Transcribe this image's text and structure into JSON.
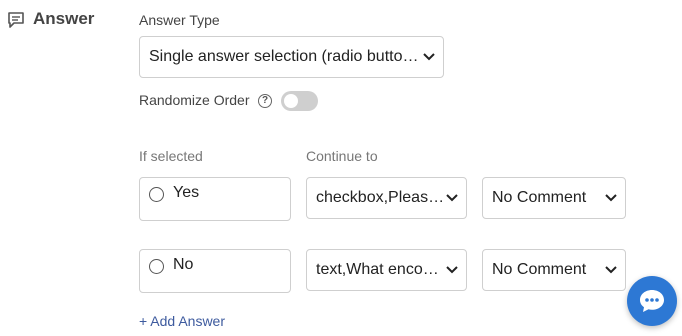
{
  "section": {
    "title": "Answer",
    "icon": "comment-lines-icon"
  },
  "answer_type": {
    "label": "Answer Type",
    "value": "Single answer selection (radio butto…"
  },
  "randomize": {
    "label": "Randomize Order",
    "help": "?",
    "enabled": false
  },
  "columns": {
    "if_selected": "If selected",
    "continue_to": "Continue to"
  },
  "answers": [
    {
      "label": "Yes",
      "continue_to": "checkbox,Pleas…",
      "comment": "No Comment"
    },
    {
      "label": "No",
      "continue_to": "text,What enco…",
      "comment": "No Comment"
    }
  ],
  "add_answer": "+ Add Answer",
  "colors": {
    "accent": "#2d78d4",
    "link": "#3d5a9e",
    "toggle_off": "#cfcfcf"
  }
}
